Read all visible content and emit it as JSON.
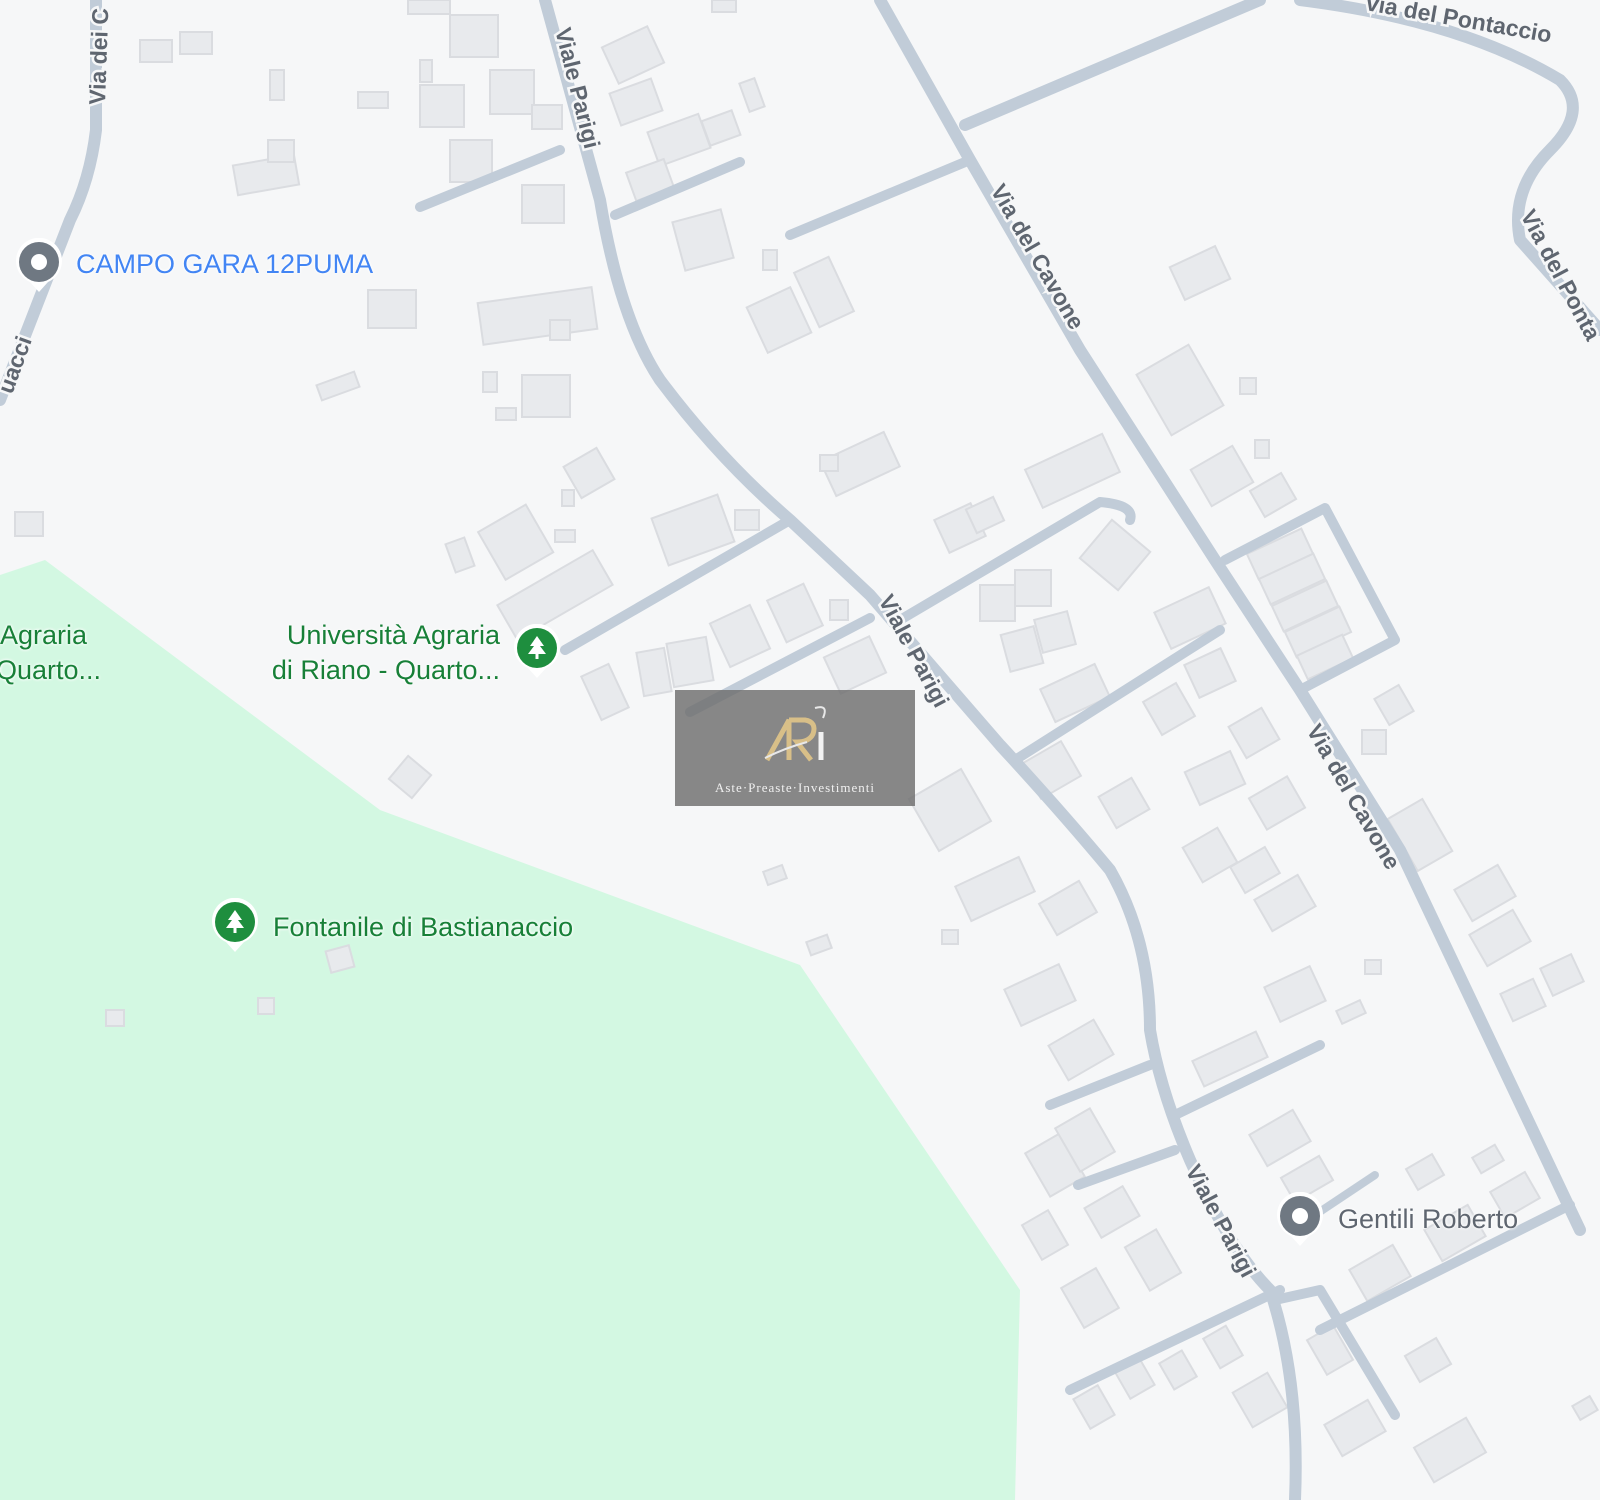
{
  "map": {
    "colors": {
      "background": "#f6f7f8",
      "park": "#d3f8e2",
      "road": "#c1ccd8",
      "building": "#e8eaed",
      "building_stroke": "#dadce0",
      "road_label": "#5f6670",
      "poi_blue": "#4285f4",
      "poi_green": "#188038",
      "poi_gray": "#5f6670"
    },
    "roads": [
      {
        "name": "Viale Parigi"
      },
      {
        "name": "Via del Cavone"
      },
      {
        "name": "Via del Pontaccio"
      },
      {
        "name": "Via dei C"
      },
      {
        "name": "uacci"
      }
    ],
    "road_labels": {
      "viale_parigi_north": "Viale Parigi",
      "viale_parigi_mid": "Viale Parigi",
      "viale_parigi_south": "Viale Parigi",
      "via_cavone_north": "Via del Cavone",
      "via_cavone_south": "Via del Cavone",
      "via_pontaccio_top": "via del Pontaccio",
      "via_pontaccio_right": "Via del Ponta",
      "via_dei_c": "Via dei C",
      "uacci": "uacci"
    },
    "pois": {
      "campo_gara": {
        "label": "CAMPO GARA 12PUMA",
        "icon": "place-pin-icon",
        "color": "#4285f4"
      },
      "universita": {
        "line1": "Università Agraria",
        "line2": "di Riano - Quarto...",
        "icon": "park-tree-icon",
        "color": "#188038"
      },
      "agraria_partial": {
        "line1": "Agraria",
        "line2": "Quarto..."
      },
      "fontanile": {
        "label": "Fontanile di Bastianaccio",
        "icon": "park-tree-icon",
        "color": "#188038"
      },
      "gentili": {
        "label": "Gentili Roberto",
        "icon": "place-pin-icon",
        "color": "#5f6670"
      }
    },
    "watermark": {
      "text": "Aste·Preaste·Investimenti",
      "logo": "RI-logo"
    }
  }
}
